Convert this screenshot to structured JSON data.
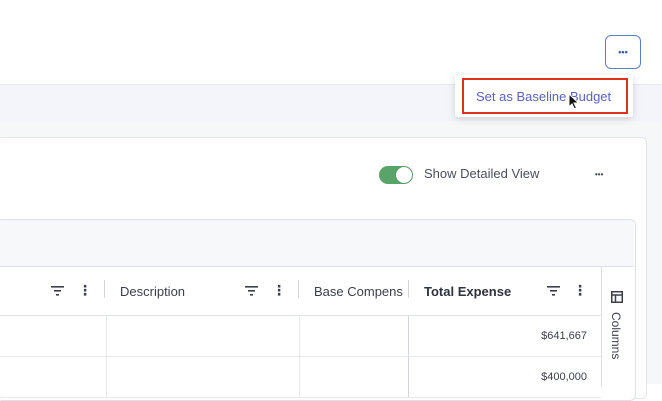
{
  "header": {
    "more_icon": "ellipsis-horizontal-icon",
    "more_glyph": "•••"
  },
  "dropdown": {
    "items": [
      {
        "label": "Set as Baseline Budget"
      }
    ]
  },
  "toolbar": {
    "toggle_label": "Show Detailed View",
    "toggle_on": true,
    "toggle_color": "#5aa469",
    "more_glyph": "•••"
  },
  "grid": {
    "columns": [
      {
        "label": ""
      },
      {
        "label": "Description"
      },
      {
        "label": "Base Compens"
      },
      {
        "label": "Total Expense"
      }
    ],
    "rows": [
      {
        "total_expense": "$641,667"
      },
      {
        "total_expense": "$400,000"
      }
    ],
    "side_panel_label": "Columns"
  },
  "colors": {
    "accent": "#2f5bb7",
    "highlight_border": "#e0301e",
    "menu_text": "#5a63b5"
  }
}
